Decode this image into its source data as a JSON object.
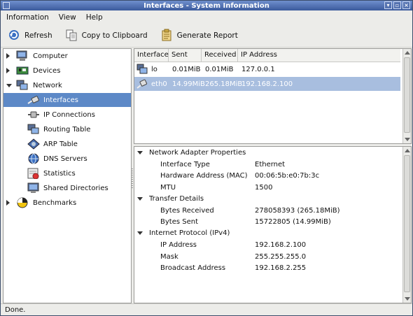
{
  "window": {
    "title": "Interfaces - System Information"
  },
  "menu": {
    "items": [
      "Information",
      "View",
      "Help"
    ]
  },
  "toolbar": {
    "refresh": "Refresh",
    "copy": "Copy to Clipboard",
    "report": "Generate Report"
  },
  "tree": {
    "items": [
      {
        "label": "Computer",
        "icon": "computer-icon"
      },
      {
        "label": "Devices",
        "icon": "devices-icon"
      },
      {
        "label": "Network",
        "icon": "network-icon"
      },
      {
        "label": "Interfaces",
        "icon": "interface-icon",
        "selected": true
      },
      {
        "label": "IP Connections",
        "icon": "connections-icon"
      },
      {
        "label": "Routing Table",
        "icon": "routing-icon"
      },
      {
        "label": "ARP Table",
        "icon": "arp-icon"
      },
      {
        "label": "DNS Servers",
        "icon": "dns-icon"
      },
      {
        "label": "Statistics",
        "icon": "statistics-icon"
      },
      {
        "label": "Shared Directories",
        "icon": "shared-dirs-icon"
      },
      {
        "label": "Benchmarks",
        "icon": "benchmarks-icon"
      }
    ]
  },
  "table": {
    "headers": [
      "Interface",
      "Sent",
      "Received",
      "IP Address"
    ],
    "rows": [
      {
        "iface": "lo",
        "sent": "0.01MiB",
        "received": "0.01MiB",
        "ip": "127.0.0.1"
      },
      {
        "iface": "eth0",
        "sent": "14.99MiB",
        "received": "265.18MiB",
        "ip": "192.168.2.100",
        "selected": true
      }
    ]
  },
  "details": {
    "sections": [
      {
        "title": "Network Adapter Properties",
        "props": [
          {
            "k": "Interface Type",
            "v": "Ethernet"
          },
          {
            "k": "Hardware Address (MAC)",
            "v": "00:06:5b:e0:7b:3c"
          },
          {
            "k": "MTU",
            "v": "1500"
          }
        ]
      },
      {
        "title": "Transfer Details",
        "props": [
          {
            "k": "Bytes Received",
            "v": "278058393 (265.18MiB)"
          },
          {
            "k": "Bytes Sent",
            "v": "15722805 (14.99MiB)"
          }
        ]
      },
      {
        "title": "Internet Protocol (IPv4)",
        "props": [
          {
            "k": "IP Address",
            "v": "192.168.2.100"
          },
          {
            "k": "Mask",
            "v": "255.255.255.0"
          },
          {
            "k": "Broadcast Address",
            "v": "192.168.2.255"
          }
        ]
      }
    ]
  },
  "status": {
    "text": "Done."
  }
}
